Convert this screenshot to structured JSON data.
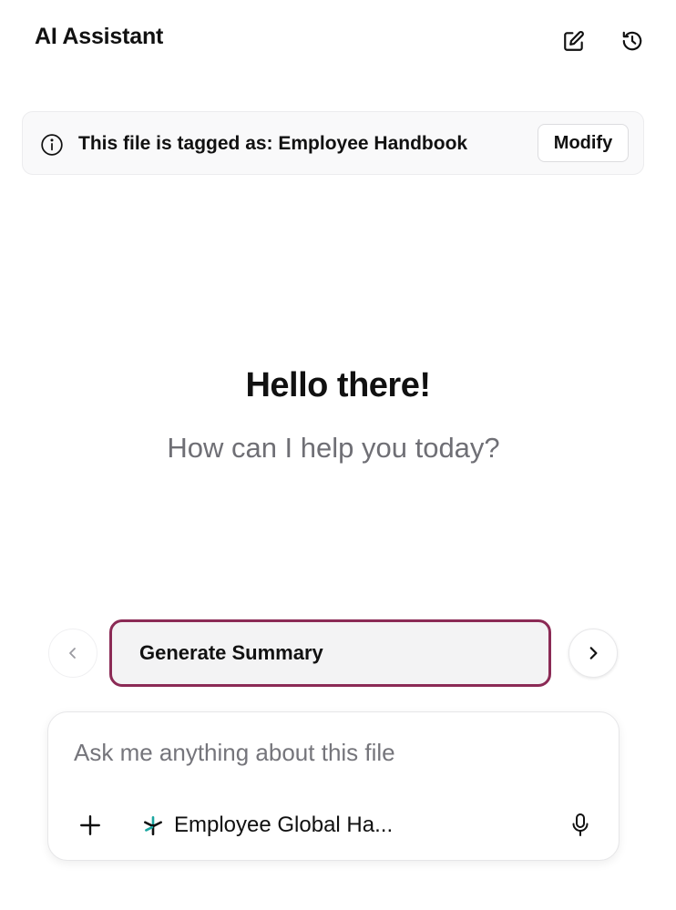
{
  "header": {
    "title": "AI Assistant",
    "icons": [
      "edit-icon",
      "history-icon"
    ]
  },
  "tag_banner": {
    "icon": "info-icon",
    "text": "This file is tagged as: Employee Handbook",
    "modify_label": "Modify"
  },
  "welcome": {
    "greeting": "Hello there!",
    "subtitle": "How can I help you today?"
  },
  "suggestions": {
    "prev_icon": "chevron-left-icon",
    "next_icon": "chevron-right-icon",
    "items": [
      {
        "label": "Generate Summary"
      }
    ]
  },
  "composer": {
    "placeholder": "Ask me anything about this file",
    "value": "",
    "add_icon": "plus-icon",
    "file_chip": {
      "icon": "file-brand-icon",
      "name": "Employee Global Ha..."
    },
    "mic_icon": "microphone-icon"
  },
  "colors": {
    "accent": "#8b2a55",
    "text_primary": "#111111",
    "text_secondary": "#6f6f75",
    "banner_bg": "#f9f9fa",
    "chip_bg": "#f3f3f4",
    "brand_teal": "#1aa6a0"
  }
}
